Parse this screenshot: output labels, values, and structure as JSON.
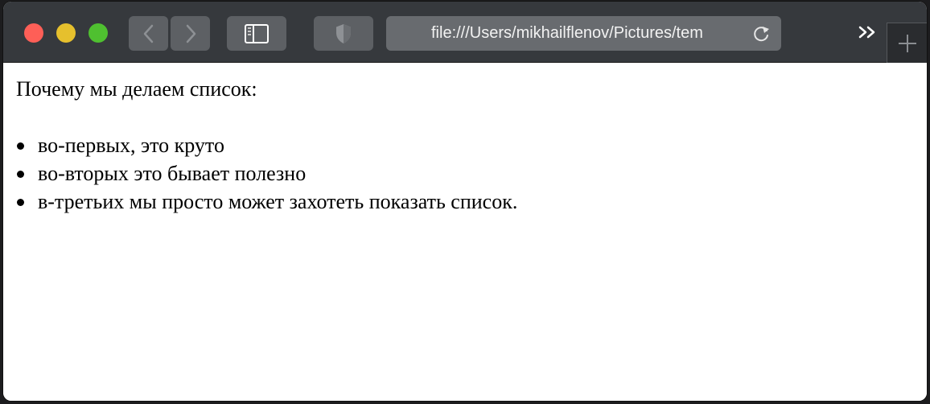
{
  "browser": {
    "url": "file:///Users/mikhailflenov/Pictures/tem",
    "buttons": {
      "back": "back",
      "forward": "forward",
      "sidebar": "sidebar",
      "privacy": "privacy-report",
      "more": "»",
      "new_tab": "+"
    },
    "icons": {
      "close": "close-window-icon",
      "minimize": "minimize-window-icon",
      "maximize": "maximize-window-icon",
      "back": "chevron-left-icon",
      "forward": "chevron-right-icon",
      "sidebar": "sidebar-icon",
      "shield": "shield-icon",
      "reload": "reload-icon",
      "overflow": "double-chevron-right-icon",
      "plus": "plus-icon"
    },
    "colors": {
      "close": "#fe5f57",
      "minimize": "#e6c02d",
      "maximize": "#4fc030",
      "toolbar": "#36393d"
    }
  },
  "page": {
    "intro": "Почему мы делаем список:",
    "items": [
      "во-первых, это круто",
      "во-вторых это бывает полезно",
      "в-третьих мы просто может захотеть показать список."
    ]
  }
}
